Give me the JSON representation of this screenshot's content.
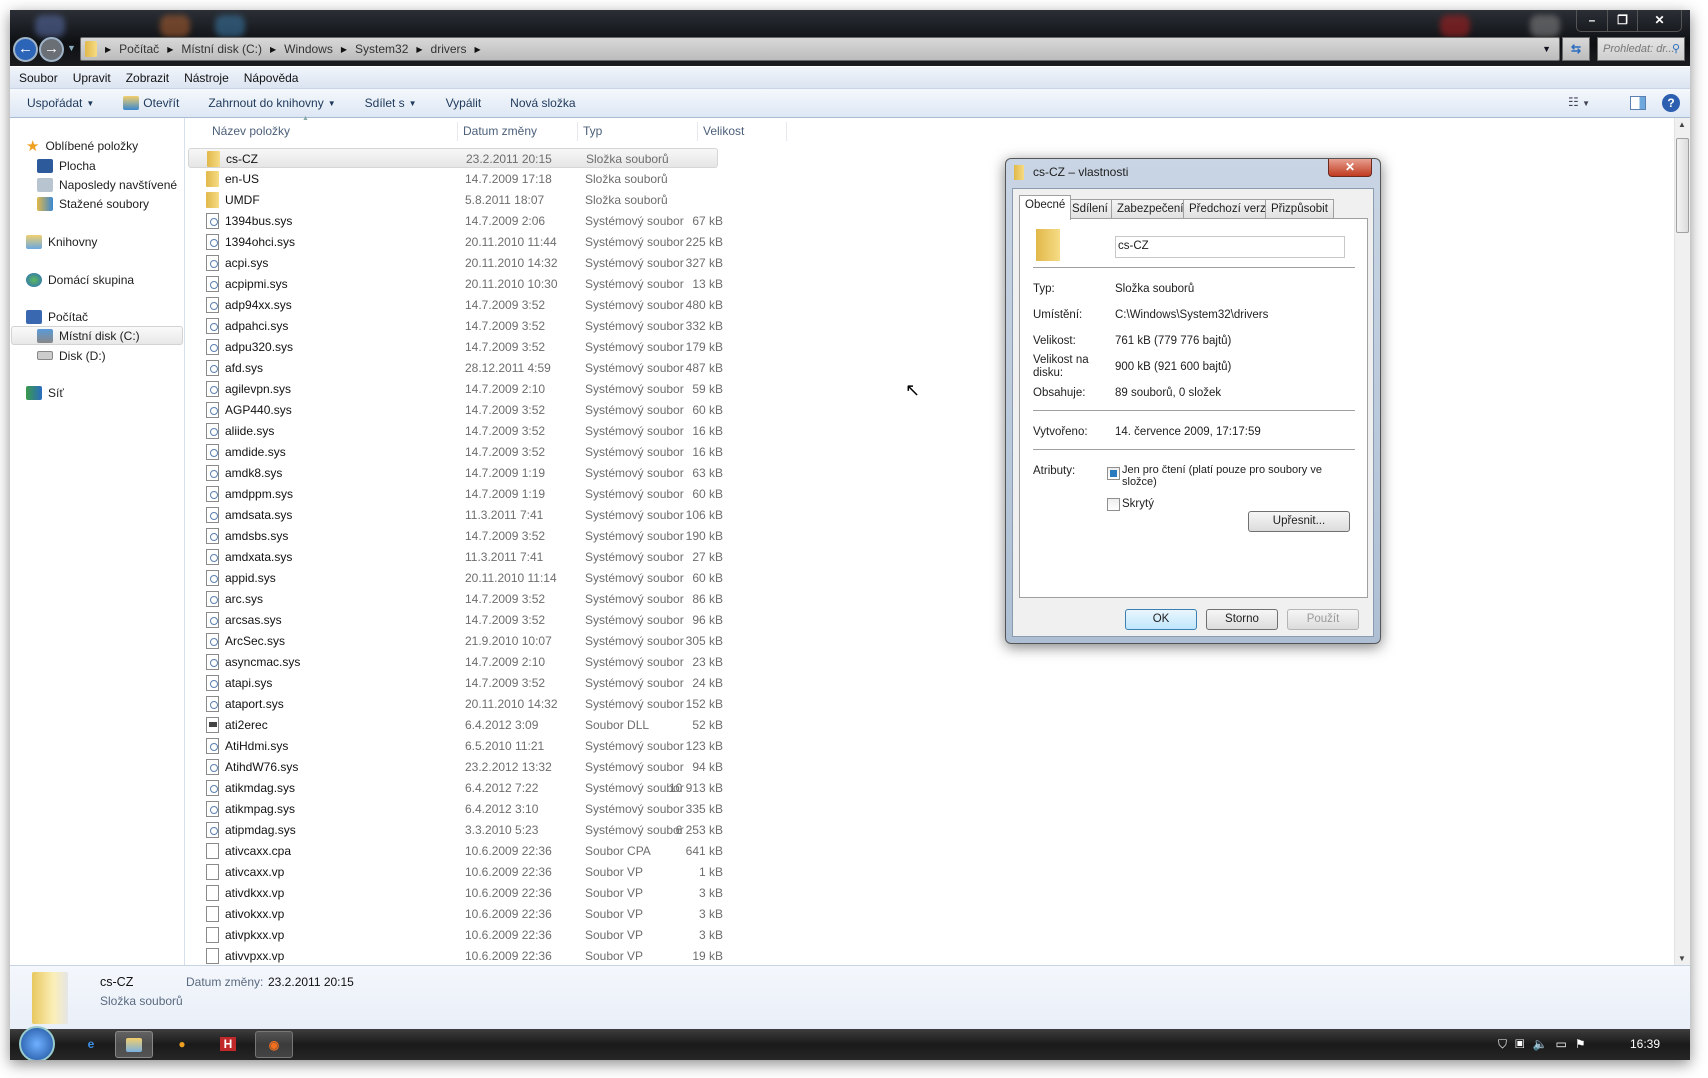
{
  "address": {
    "crumbs": [
      "Počítač",
      "Místní disk (C:)",
      "Windows",
      "System32",
      "drivers"
    ],
    "search_placeholder": "Prohledat: dr..."
  },
  "caption": {
    "minimize": "–",
    "restore": "❐",
    "close": "✕"
  },
  "menu": [
    "Soubor",
    "Upravit",
    "Zobrazit",
    "Nástroje",
    "Nápověda"
  ],
  "toolbar": {
    "organize": "Uspořádat",
    "open": "Otevřít",
    "include": "Zahrnout do knihovny",
    "share": "Sdílet s",
    "burn": "Vypálit",
    "new_folder": "Nová složka"
  },
  "nav": {
    "favorites": "Oblíbené položky",
    "desktop": "Plocha",
    "recent": "Naposledy navštívené",
    "downloads": "Stažené soubory",
    "libraries": "Knihovny",
    "homegroup": "Domácí skupina",
    "computer": "Počítač",
    "disk_c": "Místní disk (C:)",
    "disk_d": "Disk (D:)",
    "network": "Síť"
  },
  "columns": {
    "name": "Název položky",
    "date": "Datum změny",
    "type": "Typ",
    "size": "Velikost"
  },
  "files": [
    {
      "name": "cs-CZ",
      "date": "23.2.2011 20:15",
      "type": "Složka souborů",
      "size": "",
      "icon": "folder"
    },
    {
      "name": "en-US",
      "date": "14.7.2009 17:18",
      "type": "Složka souborů",
      "size": "",
      "icon": "folder"
    },
    {
      "name": "UMDF",
      "date": "5.8.2011 18:07",
      "type": "Složka souborů",
      "size": "",
      "icon": "folder"
    },
    {
      "name": "1394bus.sys",
      "date": "14.7.2009 2:06",
      "type": "Systémový soubor",
      "size": "67 kB",
      "icon": "sys"
    },
    {
      "name": "1394ohci.sys",
      "date": "20.11.2010 11:44",
      "type": "Systémový soubor",
      "size": "225 kB",
      "icon": "sys"
    },
    {
      "name": "acpi.sys",
      "date": "20.11.2010 14:32",
      "type": "Systémový soubor",
      "size": "327 kB",
      "icon": "sys"
    },
    {
      "name": "acpipmi.sys",
      "date": "20.11.2010 10:30",
      "type": "Systémový soubor",
      "size": "13 kB",
      "icon": "sys"
    },
    {
      "name": "adp94xx.sys",
      "date": "14.7.2009 3:52",
      "type": "Systémový soubor",
      "size": "480 kB",
      "icon": "sys"
    },
    {
      "name": "adpahci.sys",
      "date": "14.7.2009 3:52",
      "type": "Systémový soubor",
      "size": "332 kB",
      "icon": "sys"
    },
    {
      "name": "adpu320.sys",
      "date": "14.7.2009 3:52",
      "type": "Systémový soubor",
      "size": "179 kB",
      "icon": "sys"
    },
    {
      "name": "afd.sys",
      "date": "28.12.2011 4:59",
      "type": "Systémový soubor",
      "size": "487 kB",
      "icon": "sys"
    },
    {
      "name": "agilevpn.sys",
      "date": "14.7.2009 2:10",
      "type": "Systémový soubor",
      "size": "59 kB",
      "icon": "sys"
    },
    {
      "name": "AGP440.sys",
      "date": "14.7.2009 3:52",
      "type": "Systémový soubor",
      "size": "60 kB",
      "icon": "sys"
    },
    {
      "name": "aliide.sys",
      "date": "14.7.2009 3:52",
      "type": "Systémový soubor",
      "size": "16 kB",
      "icon": "sys"
    },
    {
      "name": "amdide.sys",
      "date": "14.7.2009 3:52",
      "type": "Systémový soubor",
      "size": "16 kB",
      "icon": "sys"
    },
    {
      "name": "amdk8.sys",
      "date": "14.7.2009 1:19",
      "type": "Systémový soubor",
      "size": "63 kB",
      "icon": "sys"
    },
    {
      "name": "amdppm.sys",
      "date": "14.7.2009 1:19",
      "type": "Systémový soubor",
      "size": "60 kB",
      "icon": "sys"
    },
    {
      "name": "amdsata.sys",
      "date": "11.3.2011 7:41",
      "type": "Systémový soubor",
      "size": "106 kB",
      "icon": "sys"
    },
    {
      "name": "amdsbs.sys",
      "date": "14.7.2009 3:52",
      "type": "Systémový soubor",
      "size": "190 kB",
      "icon": "sys"
    },
    {
      "name": "amdxata.sys",
      "date": "11.3.2011 7:41",
      "type": "Systémový soubor",
      "size": "27 kB",
      "icon": "sys"
    },
    {
      "name": "appid.sys",
      "date": "20.11.2010 11:14",
      "type": "Systémový soubor",
      "size": "60 kB",
      "icon": "sys"
    },
    {
      "name": "arc.sys",
      "date": "14.7.2009 3:52",
      "type": "Systémový soubor",
      "size": "86 kB",
      "icon": "sys"
    },
    {
      "name": "arcsas.sys",
      "date": "14.7.2009 3:52",
      "type": "Systémový soubor",
      "size": "96 kB",
      "icon": "sys"
    },
    {
      "name": "ArcSec.sys",
      "date": "21.9.2010 10:07",
      "type": "Systémový soubor",
      "size": "305 kB",
      "icon": "sys"
    },
    {
      "name": "asyncmac.sys",
      "date": "14.7.2009 2:10",
      "type": "Systémový soubor",
      "size": "23 kB",
      "icon": "sys"
    },
    {
      "name": "atapi.sys",
      "date": "14.7.2009 3:52",
      "type": "Systémový soubor",
      "size": "24 kB",
      "icon": "sys"
    },
    {
      "name": "ataport.sys",
      "date": "20.11.2010 14:32",
      "type": "Systémový soubor",
      "size": "152 kB",
      "icon": "sys"
    },
    {
      "name": "ati2erec",
      "date": "6.4.2012 3:09",
      "type": "Soubor DLL",
      "size": "52 kB",
      "icon": "dll"
    },
    {
      "name": "AtiHdmi.sys",
      "date": "6.5.2010 11:21",
      "type": "Systémový soubor",
      "size": "123 kB",
      "icon": "sys"
    },
    {
      "name": "AtihdW76.sys",
      "date": "23.2.2012 13:32",
      "type": "Systémový soubor",
      "size": "94 kB",
      "icon": "sys"
    },
    {
      "name": "atikmdag.sys",
      "date": "6.4.2012 7:22",
      "type": "Systémový soubor",
      "size": "10 913 kB",
      "icon": "sys"
    },
    {
      "name": "atikmpag.sys",
      "date": "6.4.2012 3:10",
      "type": "Systémový soubor",
      "size": "335 kB",
      "icon": "sys"
    },
    {
      "name": "atipmdag.sys",
      "date": "3.3.2010 5:23",
      "type": "Systémový soubor",
      "size": "6 253 kB",
      "icon": "sys"
    },
    {
      "name": "ativcaxx.cpa",
      "date": "10.6.2009 22:36",
      "type": "Soubor CPA",
      "size": "641 kB",
      "icon": "blank"
    },
    {
      "name": "ativcaxx.vp",
      "date": "10.6.2009 22:36",
      "type": "Soubor VP",
      "size": "1 kB",
      "icon": "blank"
    },
    {
      "name": "ativdkxx.vp",
      "date": "10.6.2009 22:36",
      "type": "Soubor VP",
      "size": "3 kB",
      "icon": "blank"
    },
    {
      "name": "ativokxx.vp",
      "date": "10.6.2009 22:36",
      "type": "Soubor VP",
      "size": "3 kB",
      "icon": "blank"
    },
    {
      "name": "ativpkxx.vp",
      "date": "10.6.2009 22:36",
      "type": "Soubor VP",
      "size": "3 kB",
      "icon": "blank"
    },
    {
      "name": "ativvpxx.vp",
      "date": "10.6.2009 22:36",
      "type": "Soubor VP",
      "size": "19 kB",
      "icon": "blank"
    }
  ],
  "details": {
    "name": "cs-CZ",
    "type": "Složka souborů",
    "date_label": "Datum změny:",
    "date_value": "23.2.2011 20:15"
  },
  "dialog": {
    "title": "cs-CZ – vlastnosti",
    "tabs": [
      "Obecné",
      "Sdílení",
      "Zabezpečení",
      "Předchozí verze",
      "Přizpůsobit"
    ],
    "name_value": "cs-CZ",
    "type_label": "Typ:",
    "type_value": "Složka souborů",
    "location_label": "Umístění:",
    "location_value": "C:\\Windows\\System32\\drivers",
    "size_label": "Velikost:",
    "size_value": "761 kB (779 776 bajtů)",
    "disk_size_label": "Velikost na disku:",
    "disk_size_value": "900 kB (921 600 bajtů)",
    "contains_label": "Obsahuje:",
    "contains_value": "89 souborů, 0 složek",
    "created_label": "Vytvořeno:",
    "created_value": "14. července 2009, 17:17:59",
    "attributes_label": "Atributy:",
    "readonly_label": "Jen pro čtení (platí pouze pro soubory ve složce)",
    "hidden_label": "Skrytý",
    "advanced_button": "Upřesnit...",
    "ok": "OK",
    "cancel": "Storno",
    "apply": "Použít"
  },
  "taskbar": {
    "clock": "16:39"
  }
}
